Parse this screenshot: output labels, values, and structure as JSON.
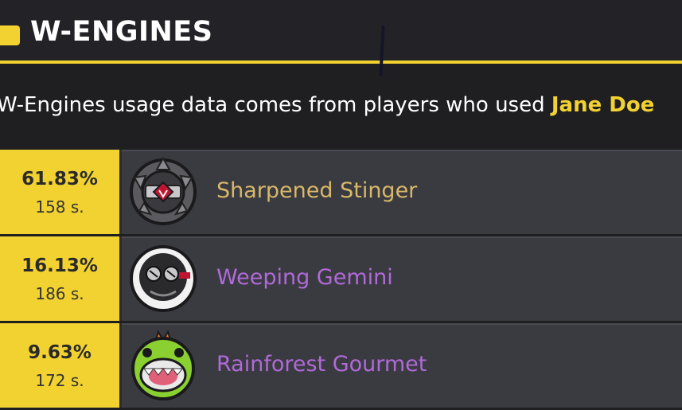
{
  "header": {
    "title": "W-ENGINES",
    "accent_color": "#f2d230"
  },
  "intro": {
    "text": "W-Engines usage data comes from players who used ",
    "character": "Jane Doe"
  },
  "engines": [
    {
      "percent": "61.83%",
      "samples": "158 s.",
      "name": "Sharpened Stinger",
      "name_color": "#d8b868",
      "icon": "sharpened-stinger-icon"
    },
    {
      "percent": "16.13%",
      "samples": "186 s.",
      "name": "Weeping Gemini",
      "name_color": "#b06ad8",
      "icon": "weeping-gemini-icon"
    },
    {
      "percent": "9.63%",
      "samples": "172 s.",
      "name": "Rainforest Gourmet",
      "name_color": "#b06ad8",
      "icon": "rainforest-gourmet-icon"
    }
  ]
}
